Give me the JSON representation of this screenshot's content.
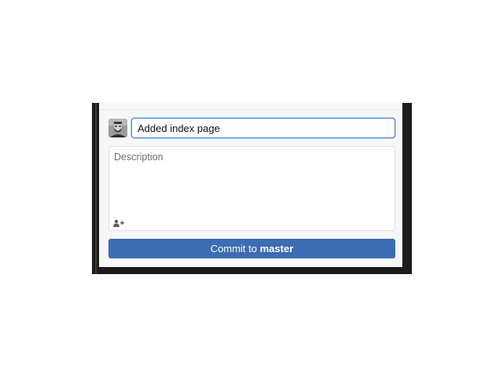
{
  "commit_panel": {
    "summary_value": "Added index page",
    "description_placeholder": "Description",
    "description_value": "",
    "commit_prefix": "Commit to",
    "branch_name": "master",
    "coauthor_icon": "add-coauthor-icon",
    "avatar_icon": "user-avatar"
  },
  "colors": {
    "button": "#3b6cb4",
    "focus_border": "#3f7fd2",
    "panel_bg": "#f6f7f8"
  }
}
